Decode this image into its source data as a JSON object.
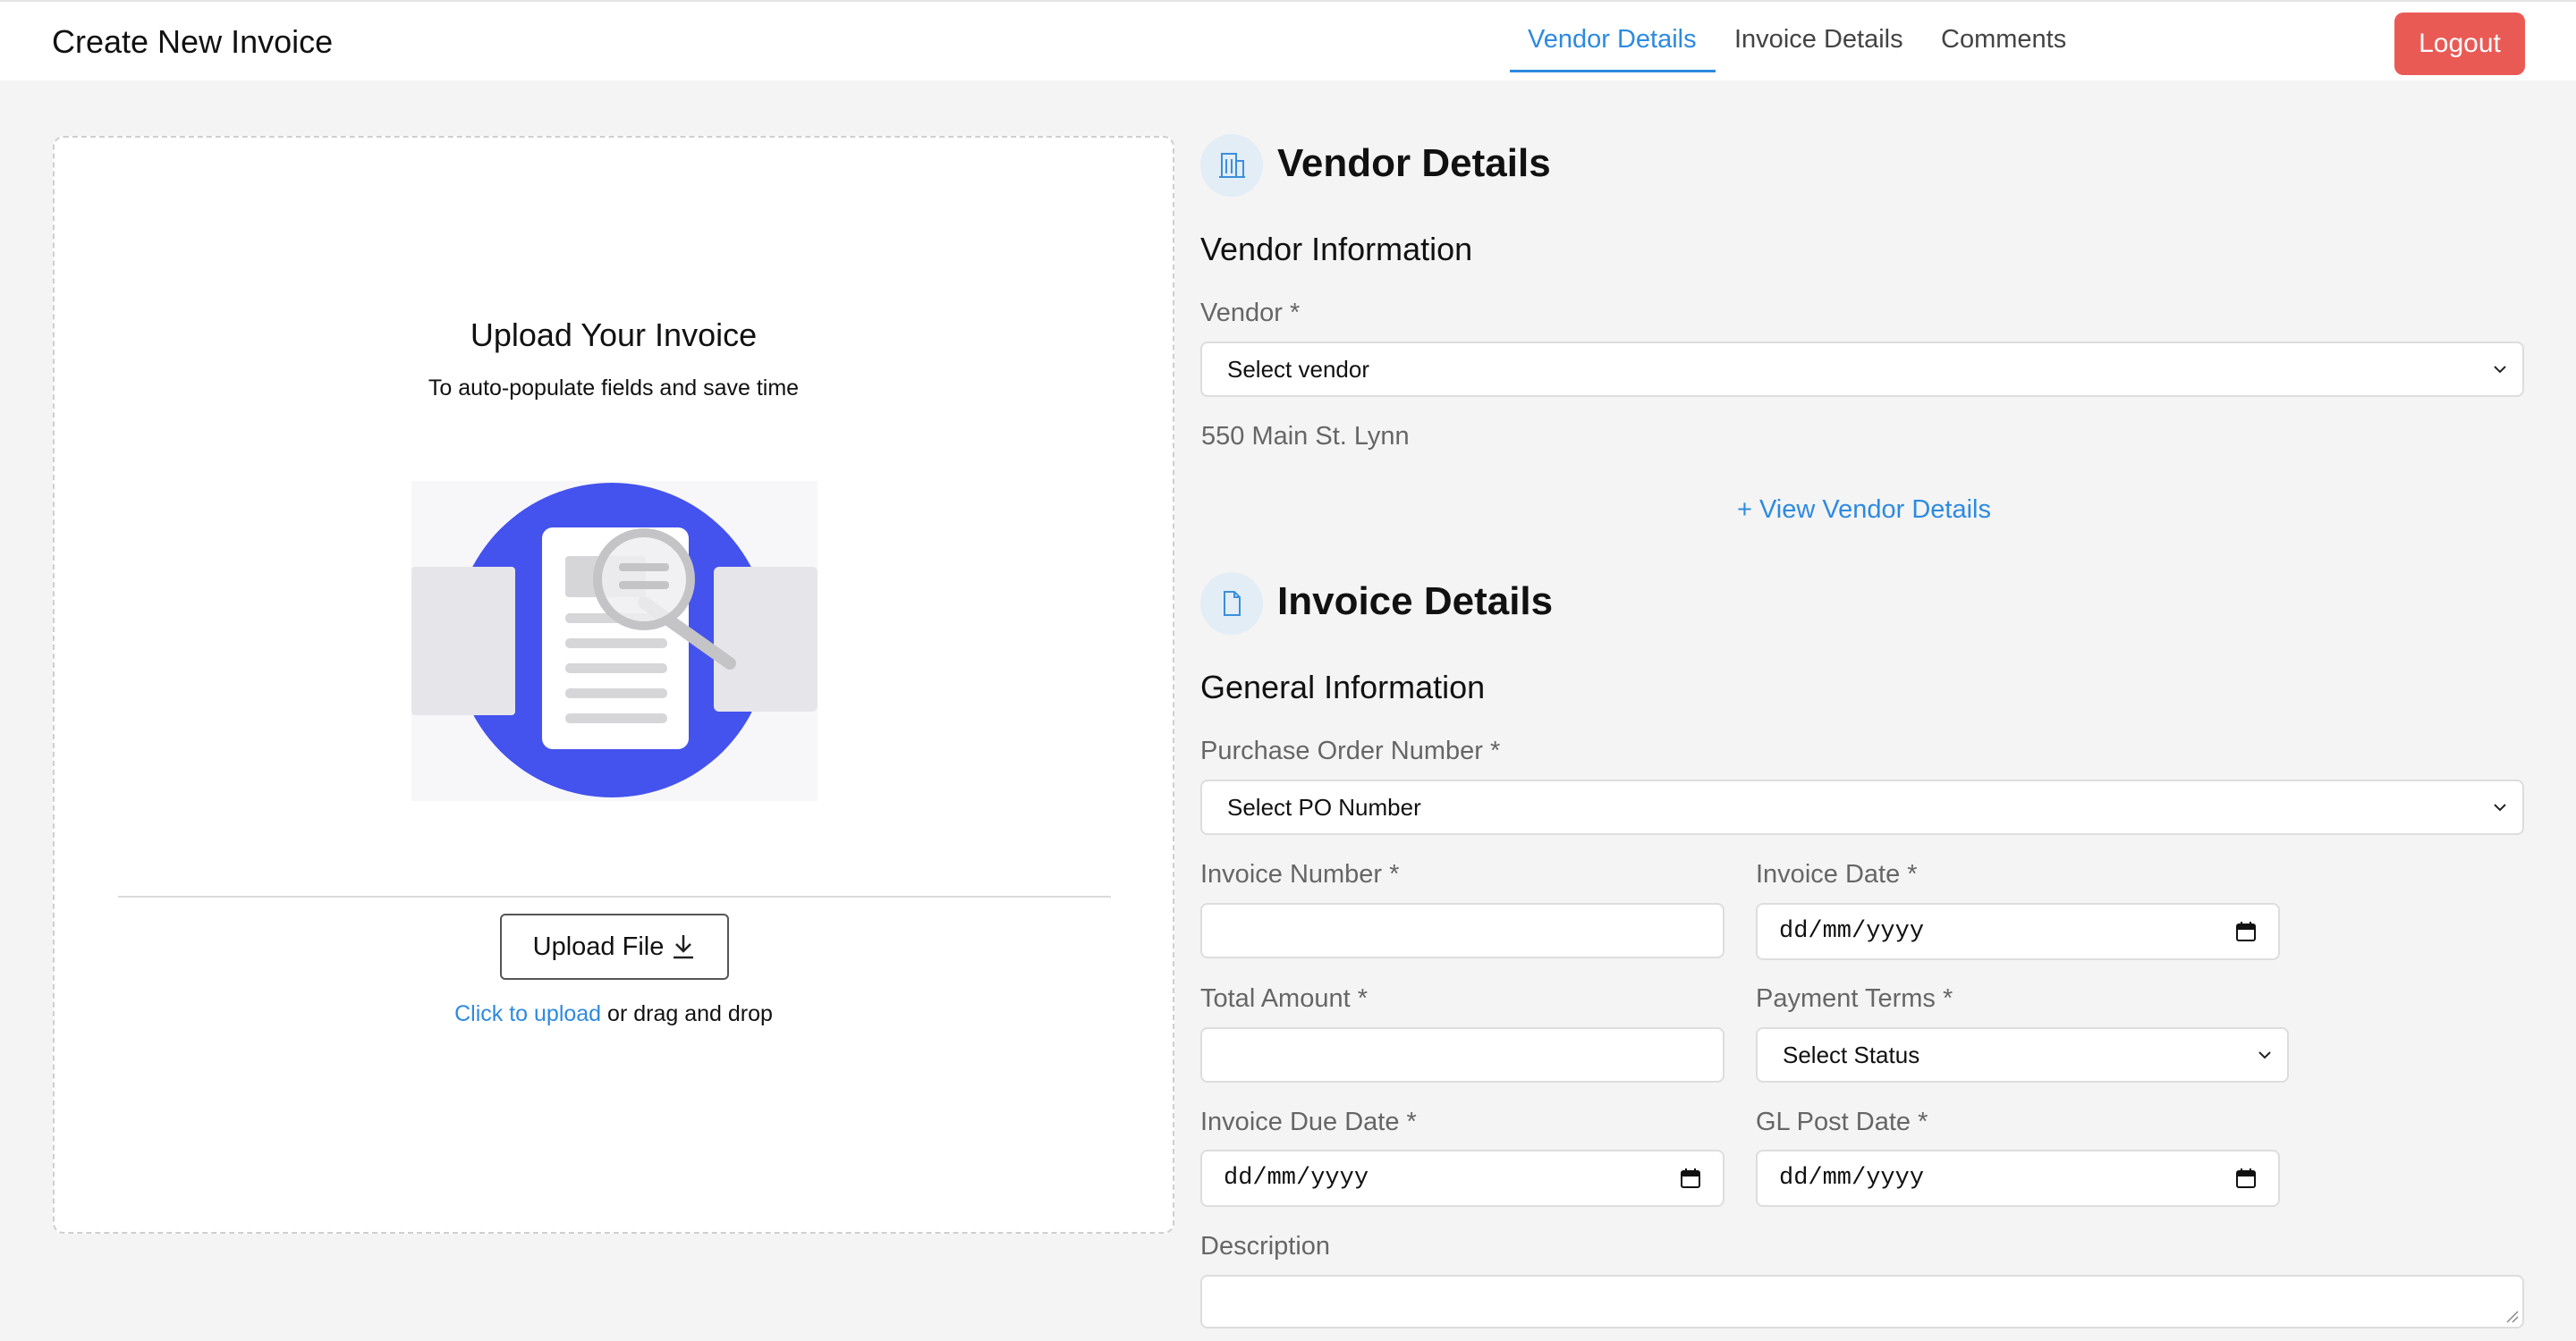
{
  "header": {
    "title": "Create New Invoice",
    "tabs": [
      {
        "label": "Vendor Details",
        "active": true
      },
      {
        "label": "Invoice Details",
        "active": false
      },
      {
        "label": "Comments",
        "active": false
      }
    ],
    "logout_label": "Logout",
    "logout_color": "#ea5a55",
    "accent_color": "#2d8ae0"
  },
  "upload": {
    "title": "Upload Your Invoice",
    "subtitle": "To auto-populate fields and save time",
    "button_label": "Upload File",
    "button_icon": "download-icon",
    "hint_link": "Click to upload",
    "hint_rest": " or drag and drop",
    "illustration_icon": "document-search-illustration"
  },
  "vendor_section": {
    "title": "Vendor Details",
    "icon": "building-icon",
    "subtitle": "Vendor Information",
    "vendor_label": "Vendor *",
    "vendor_value": "Select vendor",
    "address": "550 Main St. Lynn",
    "view_details_link": "+ View Vendor Details"
  },
  "invoice_section": {
    "title": "Invoice Details",
    "icon": "document-icon",
    "subtitle": "General Information",
    "po_label": "Purchase Order Number *",
    "po_value": "Select PO Number",
    "invoice_number_label": "Invoice Number *",
    "invoice_number_value": "",
    "invoice_date_label": "Invoice Date *",
    "invoice_date_value": "dd/mm/yyyy",
    "total_amount_label": "Total Amount *",
    "total_amount_value": "",
    "payment_terms_label": "Payment Terms *",
    "payment_terms_value": "Select Status",
    "due_date_label": "Invoice Due Date *",
    "due_date_value": "dd/mm/yyyy",
    "gl_post_date_label": "GL Post Date *",
    "gl_post_date_value": "dd/mm/yyyy",
    "description_label": "Description",
    "description_value": ""
  }
}
